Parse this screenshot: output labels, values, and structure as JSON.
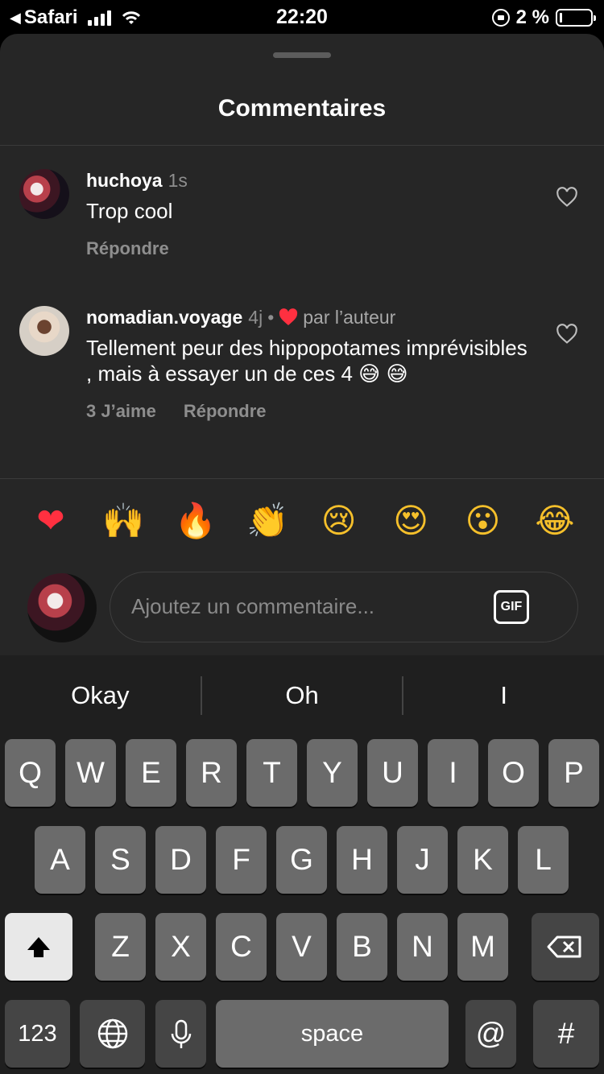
{
  "status_bar": {
    "back_app": "Safari",
    "time": "22:20",
    "battery": "2 %"
  },
  "sheet": {
    "title": "Commentaires"
  },
  "comments": [
    {
      "username": "huchoya",
      "time": "1s",
      "text": "Trop cool",
      "reply_label": "Répondre"
    },
    {
      "username": "nomadian.voyage",
      "time": "4j",
      "dot": "•",
      "liked_by_author": "par l’auteur",
      "text": "Tellement peur des hippopotames imprévisibles , mais à essayer un de ces 4 😅 😅",
      "likes_label": "3 J’aime",
      "reply_label": "Répondre"
    }
  ],
  "quick_reactions": [
    "❤",
    "🙌",
    "🔥",
    "👏",
    "😢",
    "😍",
    "😮",
    "😂"
  ],
  "composer": {
    "placeholder": "Ajoutez un commentaire...",
    "gif_label": "GIF"
  },
  "keyboard": {
    "suggestions": [
      "Okay",
      "Oh",
      "I"
    ],
    "row1": [
      "Q",
      "W",
      "E",
      "R",
      "T",
      "Y",
      "U",
      "I",
      "O",
      "P"
    ],
    "row2": [
      "A",
      "S",
      "D",
      "F",
      "G",
      "H",
      "J",
      "K",
      "L"
    ],
    "row3": [
      "Z",
      "X",
      "C",
      "V",
      "B",
      "N",
      "M"
    ],
    "numbers_key": "123",
    "space_key": "space",
    "at_key": "@",
    "hash_key": "#"
  },
  "colors": {
    "sheet_bg": "#262626",
    "keyboard_bg": "#1f1f1f",
    "key_bg": "#6b6b6b",
    "heart_red": "#ff3040",
    "muted_text": "#8e8e8e"
  }
}
